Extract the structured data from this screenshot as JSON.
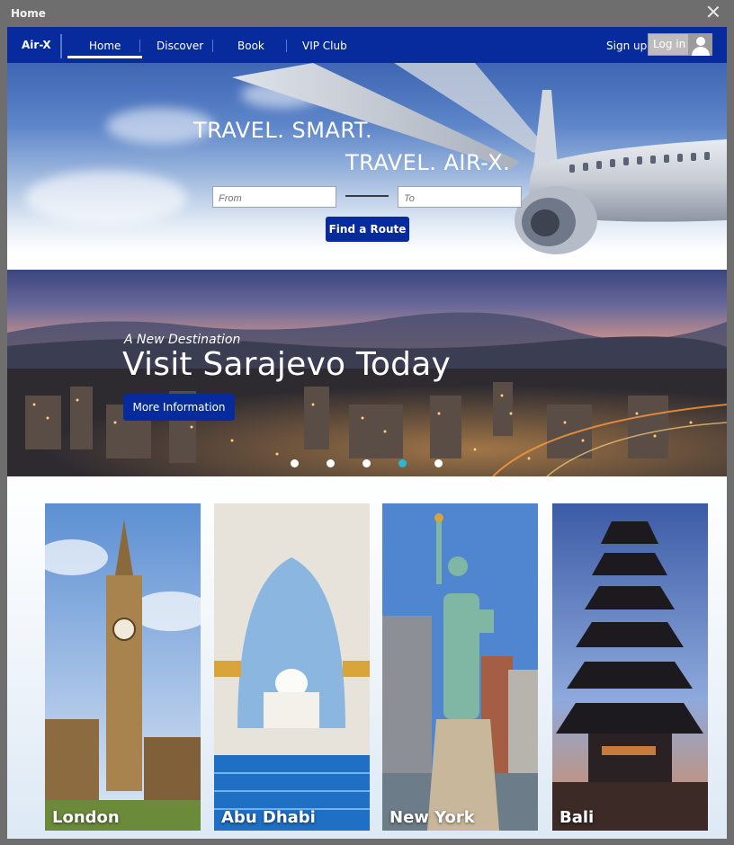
{
  "window": {
    "title": "Home"
  },
  "nav": {
    "brand": "Air-X",
    "items": [
      "Home",
      "Discover",
      "Book",
      "VIP Club"
    ],
    "signup": "Sign up",
    "login": "Log in"
  },
  "hero": {
    "line1": "TRAVEL. SMART.",
    "line2": "TRAVEL. AIR-X.",
    "from_placeholder": "From",
    "to_placeholder": "To",
    "find_button": "Find a Route"
  },
  "banner": {
    "kicker": "A New Destination",
    "title": "Visit Sarajevo Today",
    "button": "More Information",
    "slides_count": 5,
    "active_slide": 4
  },
  "destinations": [
    {
      "label": "London"
    },
    {
      "label": "Abu Dhabi"
    },
    {
      "label": "New York"
    },
    {
      "label": "Bali"
    }
  ],
  "colors": {
    "brand_blue": "#072b9c",
    "active_dot": "#2ab7d8"
  }
}
